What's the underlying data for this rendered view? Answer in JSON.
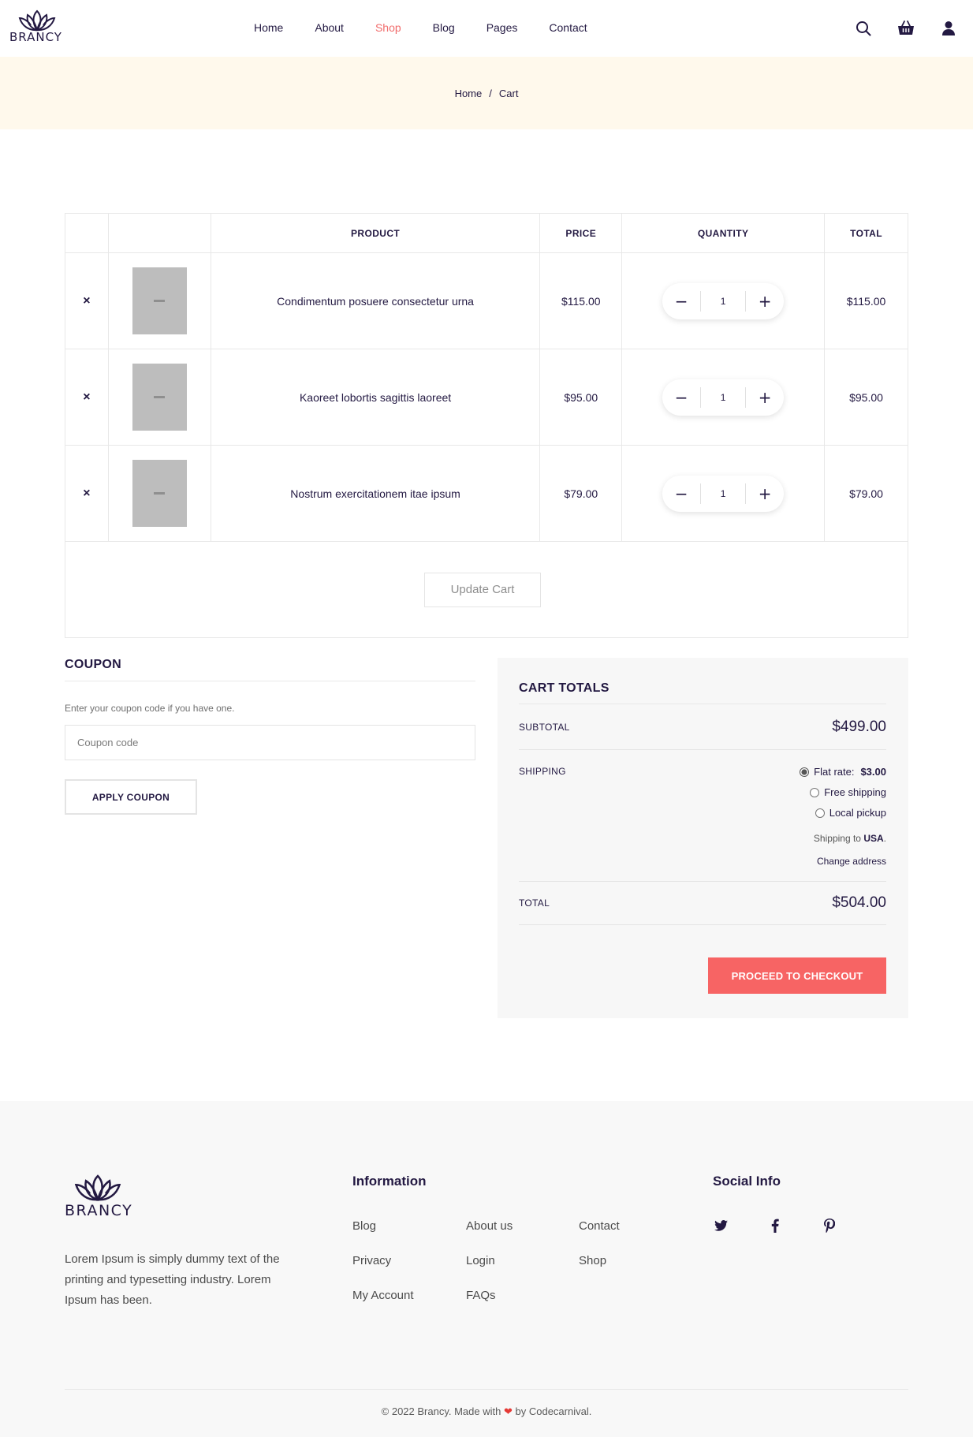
{
  "brand": {
    "name": "BRANCY"
  },
  "nav": {
    "items": [
      {
        "label": "Home"
      },
      {
        "label": "About"
      },
      {
        "label": "Shop"
      },
      {
        "label": "Blog"
      },
      {
        "label": "Pages"
      },
      {
        "label": "Contact"
      }
    ],
    "active": "Shop"
  },
  "header_icons": [
    "search-icon",
    "cart-icon",
    "user-icon"
  ],
  "breadcrumb": {
    "home": "Home",
    "separator": "/",
    "current": "Cart"
  },
  "cart": {
    "columns": [
      "",
      "",
      "PRODUCT",
      "PRICE",
      "QUANTITY",
      "TOTAL"
    ],
    "items": [
      {
        "remove": "×",
        "name": "Condimentum posuere consectetur urna",
        "price": "$115.00",
        "qty": "1",
        "total": "$115.00"
      },
      {
        "remove": "×",
        "name": "Kaoreet lobortis sagittis laoreet",
        "price": "$95.00",
        "qty": "1",
        "total": "$95.00"
      },
      {
        "remove": "×",
        "name": "Nostrum exercitationem itae ipsum",
        "price": "$79.00",
        "qty": "1",
        "total": "$79.00"
      }
    ],
    "update_label": "Update Cart"
  },
  "coupon": {
    "title": "COUPON",
    "description": "Enter your coupon code if you have one.",
    "placeholder": "Coupon code",
    "button": "APPLY COUPON"
  },
  "totals": {
    "title": "CART TOTALS",
    "subtotal_label": "SUBTOTAL",
    "subtotal": "$499.00",
    "shipping_label": "SHIPPING",
    "options": [
      {
        "label": "Flat rate:",
        "price": "$3.00",
        "selected": true
      },
      {
        "label": "Free shipping",
        "selected": false
      },
      {
        "label": "Local pickup",
        "selected": false
      }
    ],
    "shipping_to_prefix": "Shipping to",
    "shipping_to_country": "USA",
    "shipping_to_suffix": ".",
    "change_address": "Change address",
    "total_label": "TOTAL",
    "total": "$504.00",
    "checkout": "PROCEED TO CHECKOUT"
  },
  "footer": {
    "about": "Lorem Ipsum is simply dummy text of the printing and typesetting industry. Lorem Ipsum has been.",
    "info_title": "Information",
    "links": [
      "Blog",
      "About us",
      "Contact",
      "Privacy",
      "Login",
      "Shop",
      "My Account",
      "FAQs"
    ],
    "social_title": "Social Info",
    "social_icons": [
      "twitter-icon",
      "facebook-icon",
      "pinterest-icon"
    ],
    "copyright_prefix": "© 2022 Brancy. Made with",
    "copyright_suffix": "by Codecarnival."
  },
  "colors": {
    "accent": "#f16c6c",
    "checkout": "#f76464",
    "crumb_bg": "#fff9ec",
    "panel_bg": "#f7f7f7"
  }
}
